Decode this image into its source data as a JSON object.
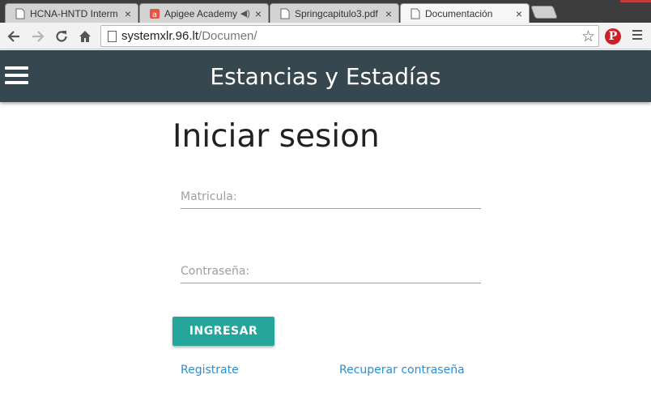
{
  "browser": {
    "tabs": [
      {
        "title": "HCNA-HNTD Interm",
        "active": false,
        "audio": false
      },
      {
        "title": "Apigee Academy",
        "active": false,
        "audio": true
      },
      {
        "title": "Springcapitulo3.pdf",
        "active": false,
        "audio": false
      },
      {
        "title": "Documentación",
        "active": true,
        "audio": false
      }
    ],
    "tab_close_glyph": "×",
    "url_host": "systemxlr.96.lt",
    "url_path": "/Documen/"
  },
  "app": {
    "title": "Estancias y Estadías"
  },
  "login": {
    "heading": "Iniciar sesion",
    "matricula_placeholder": "Matricula:",
    "password_placeholder": "Contraseña:",
    "submit_label": "INGRESAR",
    "register_link": "Registrate",
    "recover_link": "Recuperar contraseña"
  },
  "colors": {
    "appbar": "#37474f",
    "primary_button": "#26a69a",
    "link": "#2b8fd0",
    "tabstrip": "#3d3d3d"
  }
}
